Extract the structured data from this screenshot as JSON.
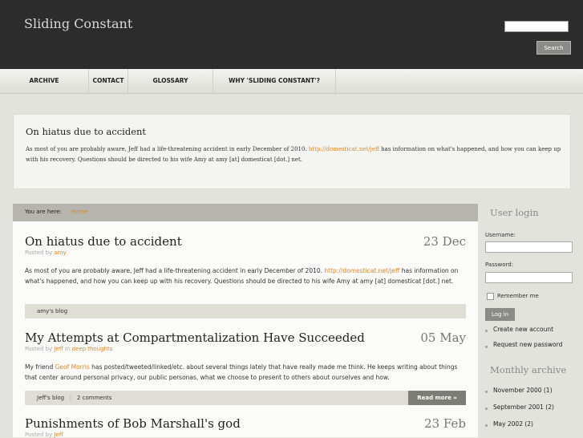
{
  "header": {
    "site_name": "Sliding Constant",
    "search_placeholder": "",
    "search_button": "Search"
  },
  "nav": {
    "items": [
      "ARCHIVE",
      "CONTACT",
      "GLOSSARY",
      "WHY 'SLIDING CONSTANT'?"
    ]
  },
  "notice": {
    "title": "On hiatus due to accident",
    "body_pre": "As most of you are probably aware, Jeff had a life-threatening accident in early December of 2010. ",
    "body_link": "http://domesticat.net/jeff",
    "body_post": " has information on what's happened, and how you can keep up with his recovery. Questions should be directed to his wife Amy at amy [at] domesticat [dot.] net."
  },
  "breadcrumb": {
    "label": "You are here:",
    "link": "Home"
  },
  "posts": [
    {
      "title": "On hiatus due to accident",
      "date": "23 Dec",
      "byline_prefix": "Posted by",
      "author": "amy",
      "body_pre": "As most of you are probably aware, Jeff had a life-threatening accident in early December of 2010. ",
      "body_link": "http://domesticat.net/jeff",
      "body_post": " has information on what's happened, and how you can keep up with his recovery. Questions should be directed to his wife Amy at amy [at] domesticat [dot.] net.",
      "blog_link": "amy's blog"
    },
    {
      "title": "My Attempts at Compartmentalization Have Succeeded",
      "date": "05 May",
      "byline_prefix": "Posted by",
      "author": "Jeff",
      "byline_in": "in",
      "category": "deep thoughts",
      "body_pre": "My friend ",
      "body_link": "Geof Morris",
      "body_post": " has posted/tweeted/linked/etc. about several things lately that have really made me think. He keeps writing about things that center around personal privacy, our public personas, what we choose to present to others about ourselves and how.",
      "blog_link": "Jeff's blog",
      "separator": "|",
      "comments": "2 comments",
      "read_more": "Read more »"
    },
    {
      "title": "Punishments of Bob Marshall's god",
      "date": "23 Feb",
      "byline_prefix": "Posted by",
      "author": "Jeff"
    }
  ],
  "sidebar": {
    "login_title": "User login",
    "username_label": "Username:",
    "password_label": "Password:",
    "remember_label": "Remember me",
    "login_button": "Log in",
    "create_account": "Create new account",
    "request_password": "Request new password",
    "archive_title": "Monthly archive",
    "archive_items": [
      "November 2000 (1)",
      "September 2001 (2)",
      "May 2002 (2)"
    ]
  }
}
